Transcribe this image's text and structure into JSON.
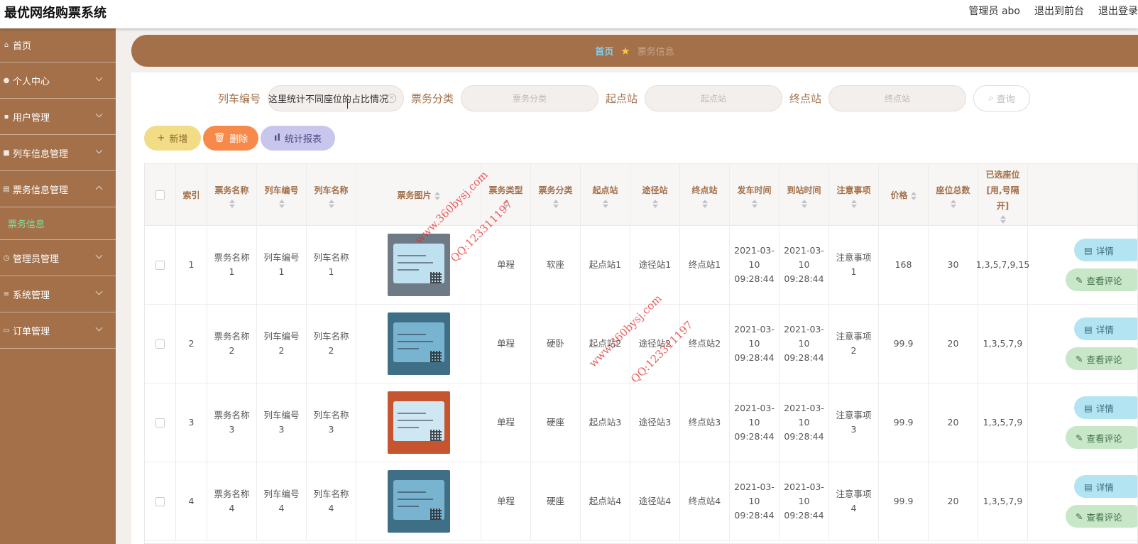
{
  "header": {
    "brand": "最优网络购票系统",
    "admin_label": "管理员 abo",
    "to_front": "退出到前台",
    "logout": "退出登录"
  },
  "sidebar": {
    "items": [
      {
        "label": "首页",
        "icon": "home-icon"
      },
      {
        "label": "个人中心",
        "icon": "user-icon"
      },
      {
        "label": "用户管理",
        "icon": "users-icon"
      },
      {
        "label": "列车信息管理",
        "icon": "train-icon"
      },
      {
        "label": "票务信息管理",
        "icon": "document-icon"
      },
      {
        "label": "管理员管理",
        "icon": "clock-icon"
      },
      {
        "label": "系统管理",
        "icon": "menu-icon"
      },
      {
        "label": "订单管理",
        "icon": "order-icon"
      }
    ],
    "sub_active": "票务信息"
  },
  "breadcrumb": {
    "home": "首页",
    "current": "票务信息"
  },
  "search": {
    "train_no_label": "列车编号",
    "train_no_value": "这里统计不同座位的占比情况",
    "category_label": "票务分类",
    "category_placeholder": "票务分类",
    "start_label": "起点站",
    "start_placeholder": "起点站",
    "end_label": "终点站",
    "end_placeholder": "终点站",
    "query_label": "查询"
  },
  "actions": {
    "add": "新增",
    "delete": "删除",
    "report": "统计报表"
  },
  "table": {
    "columns": [
      "索引",
      "票务名称",
      "列车编号",
      "列车名称",
      "票务图片",
      "票务类型",
      "票务分类",
      "起点站",
      "途径站",
      "终点站",
      "发车时间",
      "到站时间",
      "注意事项",
      "价格",
      "座位总数",
      "已选座位[用,号隔开]"
    ],
    "rows": [
      {
        "index": "1",
        "name": "票务名称1",
        "train_no": "列车编号1",
        "train_name": "列车名称1",
        "type": "单程",
        "category": "软座",
        "start": "起点站1",
        "via": "途径站1",
        "end": "终点站1",
        "depart": "2021-03-10 09:28:44",
        "arrive": "2021-03-10 09:28:44",
        "notes": "注意事项1",
        "price": "168",
        "seats": "30",
        "selected": "1,3,5,7,9,15"
      },
      {
        "index": "2",
        "name": "票务名称2",
        "train_no": "列车编号2",
        "train_name": "列车名称2",
        "type": "单程",
        "category": "硬卧",
        "start": "起点站2",
        "via": "途径站2",
        "end": "终点站2",
        "depart": "2021-03-10 09:28:44",
        "arrive": "2021-03-10 09:28:44",
        "notes": "注意事项2",
        "price": "99.9",
        "seats": "20",
        "selected": "1,3,5,7,9"
      },
      {
        "index": "3",
        "name": "票务名称3",
        "train_no": "列车编号3",
        "train_name": "列车名称3",
        "type": "单程",
        "category": "硬座",
        "start": "起点站3",
        "via": "途径站3",
        "end": "终点站3",
        "depart": "2021-03-10 09:28:44",
        "arrive": "2021-03-10 09:28:44",
        "notes": "注意事项3",
        "price": "99.9",
        "seats": "20",
        "selected": "1,3,5,7,9"
      },
      {
        "index": "4",
        "name": "票务名称4",
        "train_no": "列车编号4",
        "train_name": "列车名称4",
        "type": "单程",
        "category": "硬座",
        "start": "起点站4",
        "via": "途径站4",
        "end": "终点站4",
        "depart": "2021-03-10 09:28:44",
        "arrive": "2021-03-10 09:28:44",
        "notes": "注意事项4",
        "price": "99.9",
        "seats": "20",
        "selected": "1,3,5,7,9"
      }
    ],
    "op_detail": "详情",
    "op_review": "查看评论"
  },
  "watermarks": [
    "www.360bysj.com",
    "QQ:123311197"
  ],
  "colors": {
    "brand_brown": "#a3704a",
    "submenu_active": "#7fe09c",
    "breadcrumb_home": "#7fd0f0"
  }
}
